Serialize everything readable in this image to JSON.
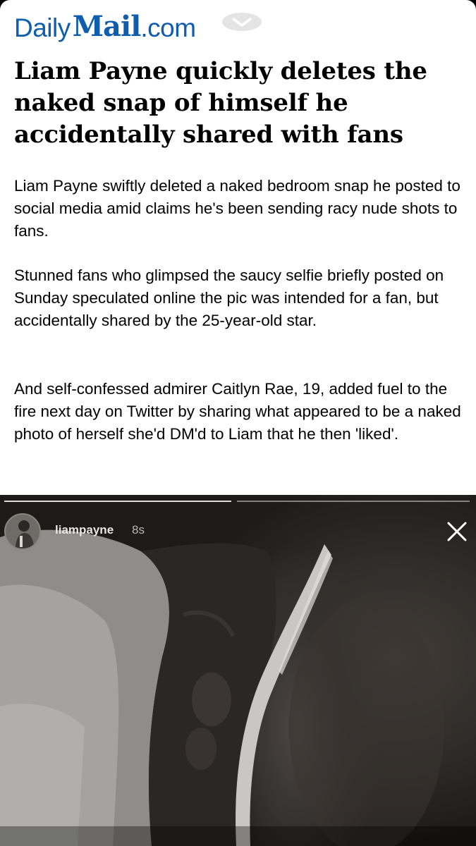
{
  "masthead": {
    "logo_daily": "Daily",
    "logo_mail": "Mail",
    "logo_com": ".com",
    "menu_icon": "chevron-down-icon",
    "brand_color": "#0f5ead"
  },
  "article": {
    "headline": "Liam Payne quickly deletes the naked snap of himself he accidentally shared with fans",
    "paragraphs": [
      "Liam Payne swiftly deleted a naked bedroom snap he posted to social media amid claims he's been sending racy nude shots to fans.",
      "Stunned fans who glimpsed the saucy selfie briefly posted on Sunday speculated online the pic was intended for a fan, but accidentally shared by the 25-year-old star.",
      "And self-confessed admirer Caitlyn Rae, 19, added fuel to the fire next day on Twitter by sharing what appeared to be a naked photo of herself she'd DM'd to Liam that he then 'liked'."
    ]
  },
  "story": {
    "username": "liampayne",
    "time_ago": "8s",
    "close_icon": "close-icon",
    "segments_total": 2,
    "segment_current": 2
  }
}
